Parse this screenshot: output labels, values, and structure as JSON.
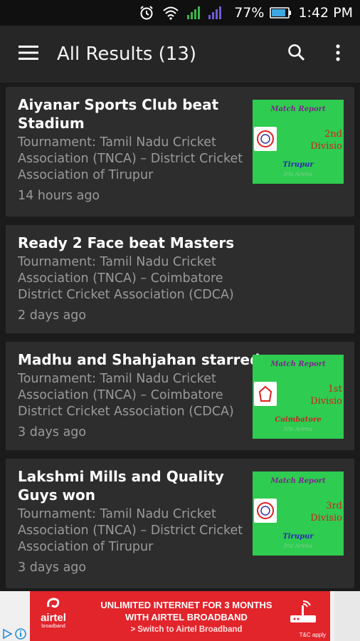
{
  "status_bar": {
    "battery": "77%",
    "time": "1:42 PM"
  },
  "app_bar": {
    "title": "All Results (13)"
  },
  "results": [
    {
      "title": "Aiyanar Sports Club beat Stadium",
      "tournament": "Tournament: Tamil Nadu Cricket Association (TNCA) – District Cricket Association of Tirupur",
      "time": "14 hours ago",
      "thumbnail": {
        "heading": "Match Report",
        "division": "2nd Divisio",
        "city": "Tirupur",
        "brand": "Iris Arena"
      }
    },
    {
      "title": "Ready 2 Face beat Masters",
      "tournament": "Tournament: Tamil Nadu Cricket Association (TNCA) – Coimbatore District Cricket Association (CDCA)",
      "time": "2 days ago"
    },
    {
      "title": "Madhu and Shahjahan starred",
      "tournament": "Tournament: Tamil Nadu Cricket Association (TNCA) – Coimbatore District Cricket Association (CDCA)",
      "time": "3 days ago",
      "thumbnail": {
        "heading": "Match Report",
        "division": "1st Divisio",
        "city": "Coimbatore",
        "brand": "Iris Arena"
      }
    },
    {
      "title": "Lakshmi Mills and Quality Guys won",
      "tournament": "Tournament: Tamil Nadu Cricket Association (TNCA) – District Cricket Association of Tirupur",
      "time": "3 days ago",
      "thumbnail": {
        "heading": "Match Report",
        "division": "3rd Divisio",
        "city": "Tirupur",
        "brand": "Iris Arena"
      }
    }
  ],
  "ad": {
    "brand": "airtel",
    "brand_sub": "broadband",
    "line1": "UNLIMITED INTERNET FOR 3 MONTHS",
    "line2": "WITH AIRTEL BROADBAND",
    "line3": "> Switch to Airtel Broadband",
    "tc": "T&C apply"
  },
  "icons": [
    "alarm-icon",
    "wifi-icon",
    "signal-icon",
    "battery-icon",
    "menu-icon",
    "search-icon",
    "overflow-icon",
    "adchoices-icon"
  ],
  "colors": {
    "app_bar": "#262626",
    "card": "#2d2d2d",
    "thumb_bg": "#2ecc50",
    "ad_red": "#e2242b"
  }
}
